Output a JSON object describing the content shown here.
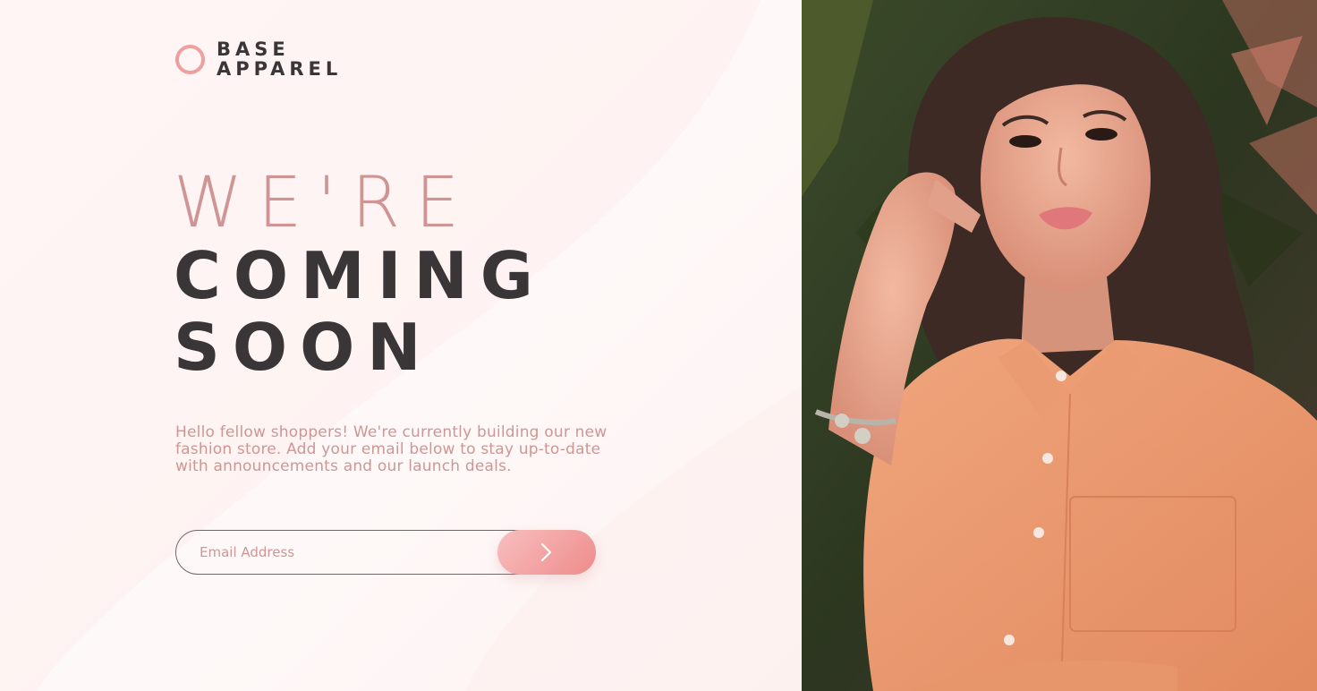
{
  "brand": {
    "line1": "BASE",
    "line2": "APPAREL",
    "accent": "#ef9f9f"
  },
  "hero": {
    "line1": "WE'RE",
    "line2": "COMING",
    "line3": "SOON"
  },
  "description": "Hello fellow shoppers! We're currently building our new fashion store. Add your email below to stay up-to-date with announcements and our launch deals.",
  "form": {
    "email_placeholder": "Email Address",
    "submit_icon": "chevron-right-icon"
  },
  "colors": {
    "primary_text": "#3a3536",
    "desaturated_red": "#ce9695",
    "gradient_start": "#f8bfbf",
    "gradient_end": "#ee8b8b"
  },
  "hero_image": {
    "subject": "woman-in-peach-shirt-photo"
  }
}
